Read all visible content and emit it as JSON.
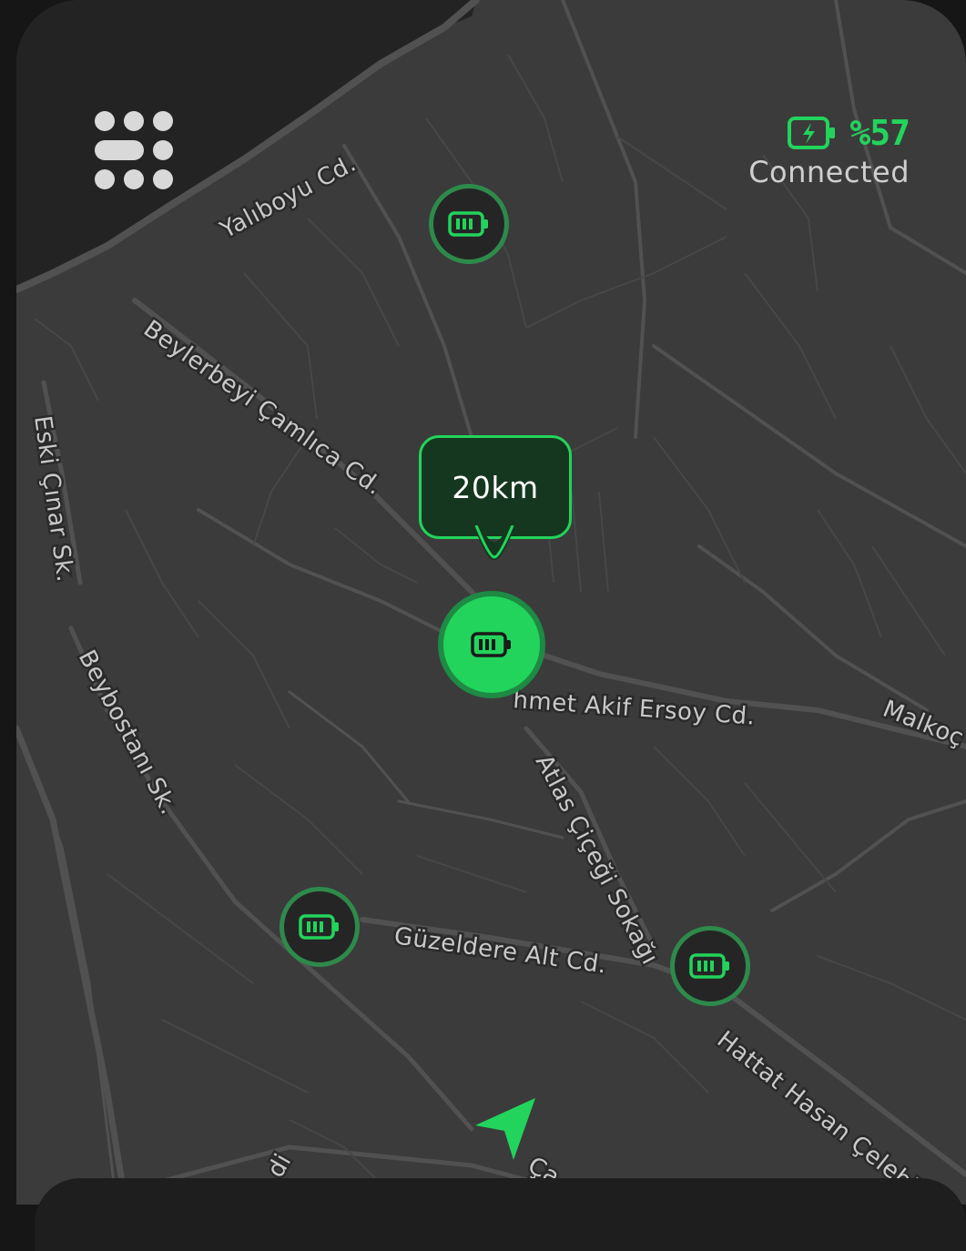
{
  "status": {
    "battery_percent": "%57",
    "connection": "Connected"
  },
  "bubble": {
    "range_label": "20km"
  },
  "streets": {
    "yaliboyu": "Yalıboyu Cd.",
    "beylerbeyi": "Beylerbeyi Çamlıca Cd.",
    "eski_cinar": "Eski Çınar Sk.",
    "beybostani": "Beybostanı Sk.",
    "mehmet_akif": "hmet Akif Ersoy Cd.",
    "malkoc": "Malkoç",
    "atlas": "Atlas Çiçeği Sokağı",
    "guzeldere": "Güzeldere Alt Cd.",
    "hattat": "Hattat Hasan Çelebi C",
    "bottom_a": "Ça",
    "bottom_b": "di"
  },
  "icons": {
    "menu": "grid-menu-icon",
    "battery_status": "battery-charging-icon",
    "station": "battery-icon",
    "navigation": "navigation-arrow-icon"
  },
  "colors": {
    "accent": "#22d45c",
    "map_bg": "#3b3b3b",
    "water": "#232323",
    "road": "#4e4e4e",
    "label": "#c9c9c9"
  }
}
